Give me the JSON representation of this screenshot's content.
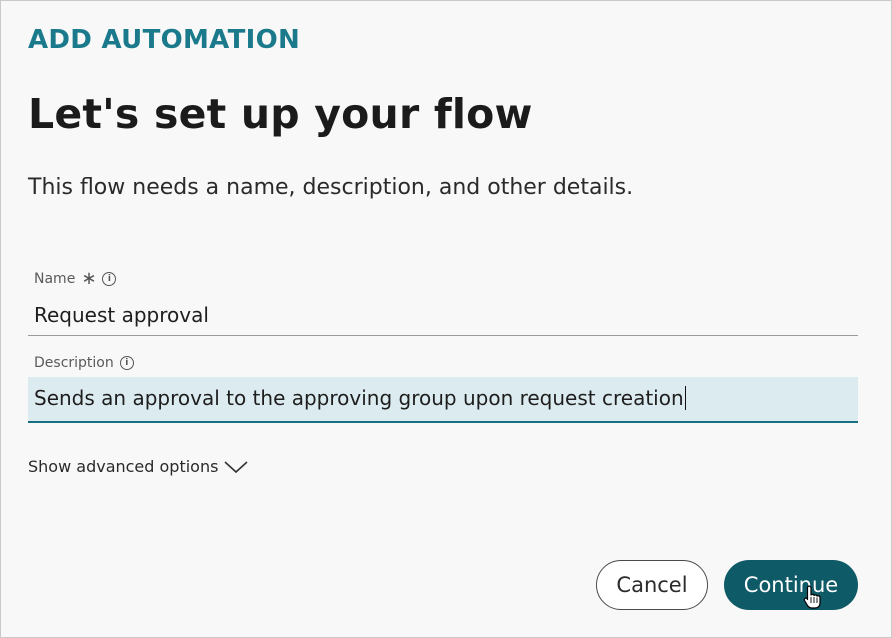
{
  "header": {
    "eyebrow": "ADD AUTOMATION",
    "title": "Let's set up your flow",
    "subtitle": "This flow needs a name, description, and other details."
  },
  "form": {
    "name": {
      "label": "Name",
      "required_mark": "∗",
      "value": "Request approval"
    },
    "description": {
      "label": "Description",
      "value": "Sends an approval to the approving group upon request creation"
    },
    "advanced_label": "Show advanced options"
  },
  "actions": {
    "cancel_label": "Cancel",
    "continue_label": "Continue"
  },
  "icons": {
    "info": "info-icon",
    "chevron": "chevron-down-icon",
    "cursor": "hand-pointer-icon"
  },
  "colors": {
    "accent": "#1a7a8c",
    "primary_button": "#0f5a67",
    "focused_input_bg": "#dcebef"
  }
}
